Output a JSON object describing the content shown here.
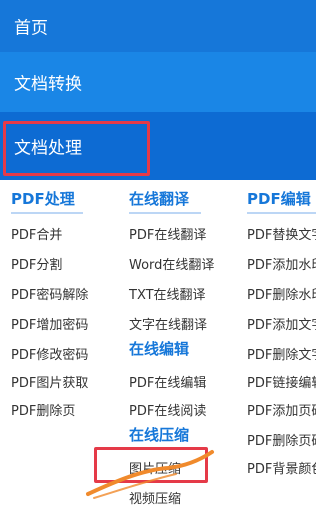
{
  "nav": {
    "home": "首页",
    "convert": "文档转换",
    "process": "文档处理"
  },
  "columns": [
    {
      "heading": "PDF处理",
      "items": [
        "PDF合并",
        "PDF分割",
        "PDF密码解除",
        "PDF增加密码",
        "PDF修改密码",
        "PDF图片获取",
        "PDF删除页"
      ]
    },
    {
      "heading": "在线翻译",
      "items": [
        "PDF在线翻译",
        "Word在线翻译",
        "TXT在线翻译",
        "文字在线翻译"
      ],
      "heading2": "在线编辑",
      "items2": [
        "PDF在线编辑",
        "PDF在线阅读"
      ],
      "heading3": "在线压缩",
      "items3": [
        "图片压缩",
        "视频压缩"
      ]
    },
    {
      "heading": "PDF编辑",
      "items": [
        "PDF替换文字",
        "PDF添加水印",
        "PDF删除水印",
        "PDF添加文字",
        "PDF删除文字",
        "PDF链接编辑",
        "PDF添加页码",
        "PDF删除页码",
        "PDF背景颜色"
      ]
    }
  ],
  "colors": {
    "nav_home": "#1677d9",
    "nav_convert": "#1a86e6",
    "nav_process": "#0d6bd3",
    "heading": "#1677d9",
    "highlight_box": "#e53a48",
    "scribble": "#f08a2c"
  }
}
